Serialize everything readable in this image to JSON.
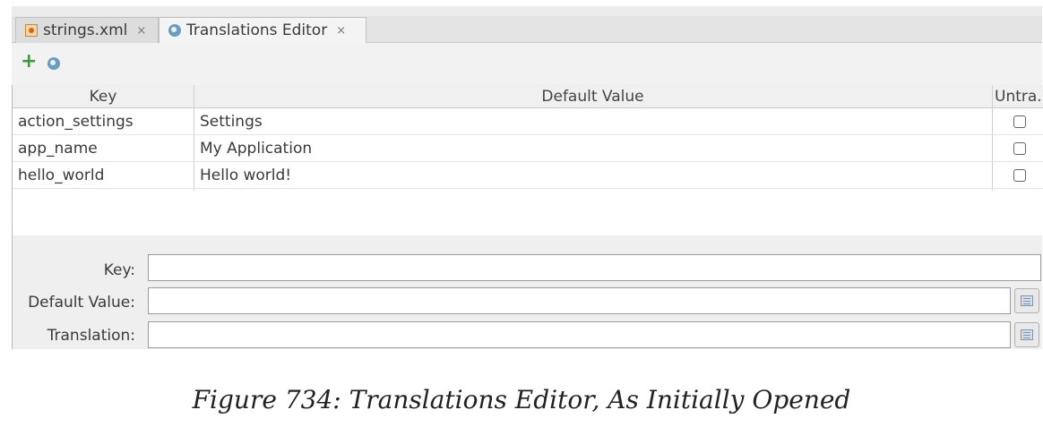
{
  "tabs": [
    {
      "label": "strings.xml",
      "icon": "xml-file-icon",
      "active": false
    },
    {
      "label": "Translations Editor",
      "icon": "globe-icon",
      "active": true
    }
  ],
  "close_glyph": "×",
  "toolbar": {
    "add_icon": "plus-icon",
    "locale_icon": "globe-icon",
    "add_glyph": "+"
  },
  "table": {
    "headers": {
      "key": "Key",
      "default_value": "Default Value",
      "untranslatable": "Untra.."
    },
    "rows": [
      {
        "key": "action_settings",
        "default_value": "Settings",
        "untranslatable": false
      },
      {
        "key": "app_name",
        "default_value": "My Application",
        "untranslatable": false
      },
      {
        "key": "hello_world",
        "default_value": "Hello world!",
        "untranslatable": false
      }
    ]
  },
  "form": {
    "key_label": "Key:",
    "default_value_label": "Default Value:",
    "translation_label": "Translation:",
    "key_value": "",
    "default_value_value": "",
    "translation_value": ""
  },
  "caption": "Figure 734: Translations Editor, As Initially Opened"
}
